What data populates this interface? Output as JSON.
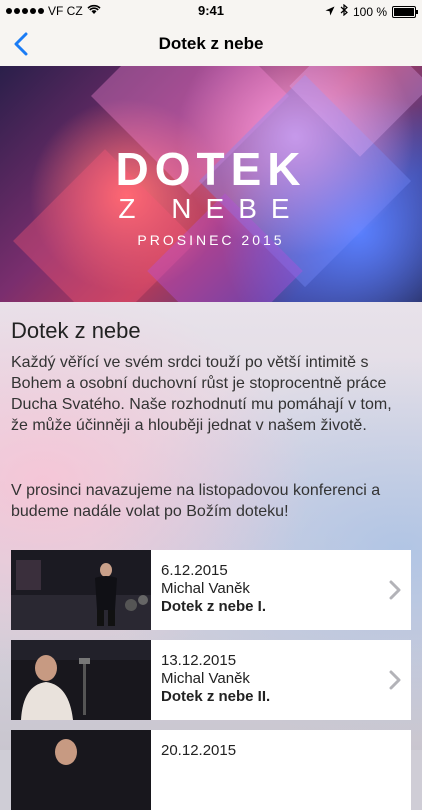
{
  "status": {
    "carrier": "VF CZ",
    "time": "9:41",
    "battery": "100 %"
  },
  "nav": {
    "title": "Dotek z nebe"
  },
  "hero": {
    "title": "DOTEK",
    "subtitle": "Z NEBE",
    "date": "PROSINEC 2015"
  },
  "content": {
    "title": "Dotek z nebe",
    "paragraphs": [
      "Každý věřící ve svém srdci touží po větší intimitě s Bohem a osobní duchovní růst je stoprocentně práce Ducha Svatého. Naše rozhodnutí mu pomáhají v tom, že může účinněji a hlouběji jednat v našem životě.",
      "V prosinci navazujeme na listopadovou konferenci a budeme nadále volat po Božím doteku!"
    ]
  },
  "sermons": [
    {
      "date": "6.12.2015",
      "speaker": "Michal Vaněk",
      "title": "Dotek z nebe I."
    },
    {
      "date": "13.12.2015",
      "speaker": "Michal Vaněk",
      "title": "Dotek z nebe II."
    },
    {
      "date": "20.12.2015",
      "speaker": "",
      "title": ""
    }
  ],
  "colors": {
    "accent": "#1a7cf5",
    "chevron": "#b3b3b8"
  },
  "icons": [
    "wifi-icon",
    "location-icon",
    "bluetooth-icon",
    "battery-icon",
    "back-chevron-icon",
    "chevron-right-icon"
  ]
}
